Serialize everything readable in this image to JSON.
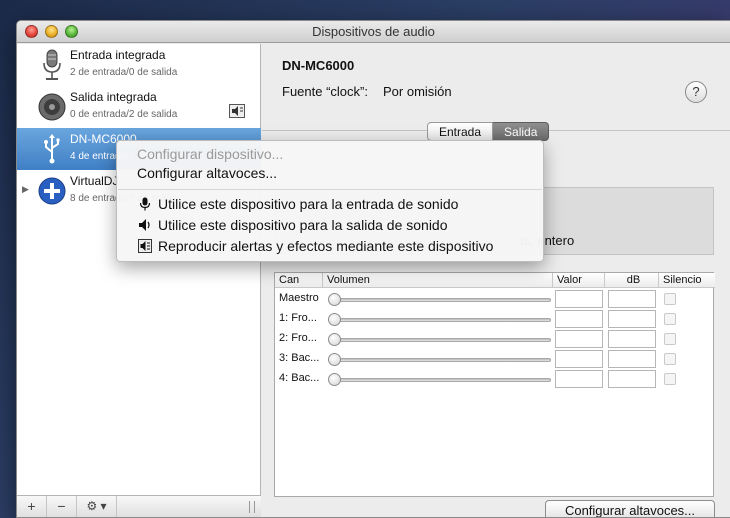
{
  "window": {
    "title": "Dispositivos de audio"
  },
  "devices": [
    {
      "name": "Entrada integrada",
      "sub": "2 de entrada/0 de salida",
      "icon": "microphone-icon"
    },
    {
      "name": "Salida integrada",
      "sub": "0 de entrada/2 de salida",
      "icon": "speaker-icon"
    },
    {
      "name": "DN-MC6000",
      "sub": "4 de entrada/4 de salida",
      "icon": "usb-icon",
      "selected": true
    },
    {
      "name": "VirtualDJ",
      "sub": "8 de entrada/8 de salida",
      "icon": "aggregate-plus-icon"
    }
  ],
  "sidebar_footer": {
    "add": "+",
    "remove": "−",
    "gear": "⚙ ▾"
  },
  "detail": {
    "device_title": "DN-MC6000",
    "clock_label": "Fuente “clock”:",
    "clock_value": "Por omisión",
    "help": "?",
    "tabs": [
      "Entrada",
      "Salida"
    ],
    "active_tab": "Salida",
    "format_text": "ts, entero",
    "table_headers": [
      "Can",
      "Volumen",
      "Valor",
      "dB",
      "Silencio"
    ],
    "rows": [
      "Maestro",
      "1: Fro...",
      "2: Fro...",
      "3: Bac...",
      "4: Bac..."
    ],
    "configure_button": "Configurar altavoces..."
  },
  "context_menu": {
    "items": [
      {
        "label": "Configurar dispositivo...",
        "enabled": false
      },
      {
        "label": "Configurar altavoces...",
        "enabled": true
      },
      {
        "label": "Utilice este dispositivo para la entrada de sonido",
        "icon": "microphone-icon"
      },
      {
        "label": "Utilice este dispositivo para la salida de sonido",
        "icon": "speaker-icon"
      },
      {
        "label": "Reproducir alertas y efectos mediante este dispositivo",
        "icon": "alert-speaker-icon"
      }
    ]
  }
}
